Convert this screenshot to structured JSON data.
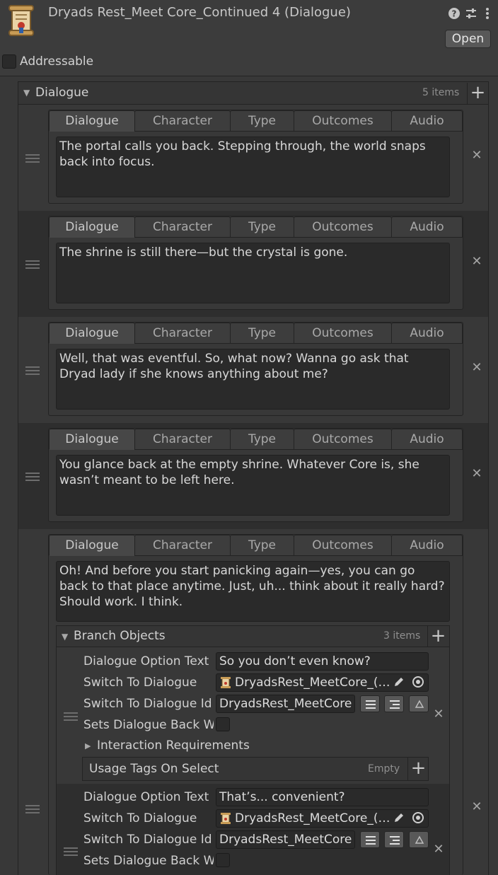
{
  "header": {
    "title": "Dryads Rest_Meet Core_Continued 4 (Dialogue)",
    "open_label": "Open",
    "addressable_label": "Addressable",
    "icons": [
      "help-icon",
      "settings-sliders-icon",
      "kebab-menu-icon"
    ]
  },
  "list": {
    "title": "Dialogue",
    "count": "5 items"
  },
  "tabs": [
    "Dialogue",
    "Character",
    "Type",
    "Outcomes",
    "Audio"
  ],
  "entries": [
    "The portal calls you back. Stepping through, the world snaps back into focus.",
    "The shrine is still there—but the crystal is gone.",
    "Well, that was eventful. So, what now? Wanna go ask that Dryad lady if she knows anything about me?",
    "You glance back at the empty shrine. Whatever Core is, she wasn’t meant to be left here.",
    "Oh! And before you start panicking again—yes, you can go back to that place anytime. Just, uh... think about it really hard? Should work. I think."
  ],
  "branch": {
    "title": "Branch Objects",
    "count": "3 items",
    "labels": {
      "option_text": "Dialogue Option Text",
      "switch_to": "Switch To Dialogue",
      "switch_to_id": "Switch To Dialogue Id",
      "sets_back": "Sets Dialogue Back W",
      "interaction": "Interaction Requirements",
      "usage": "Usage Tags On Select",
      "usage_empty": "Empty"
    },
    "items": [
      {
        "option_text": "So you don’t even know?",
        "switch_to": "DryadsRest_MeetCore_(…",
        "switch_to_id": "DryadsRest_MeetCore"
      },
      {
        "option_text": "That’s... convenient?",
        "switch_to": "DryadsRest_MeetCore_(…",
        "switch_to_id": "DryadsRest_MeetCore"
      }
    ]
  },
  "colors": {
    "background": "#383838",
    "field": "#2a2a2a",
    "text": "#d2d2d2",
    "alt_row": "#2e2e2e"
  }
}
